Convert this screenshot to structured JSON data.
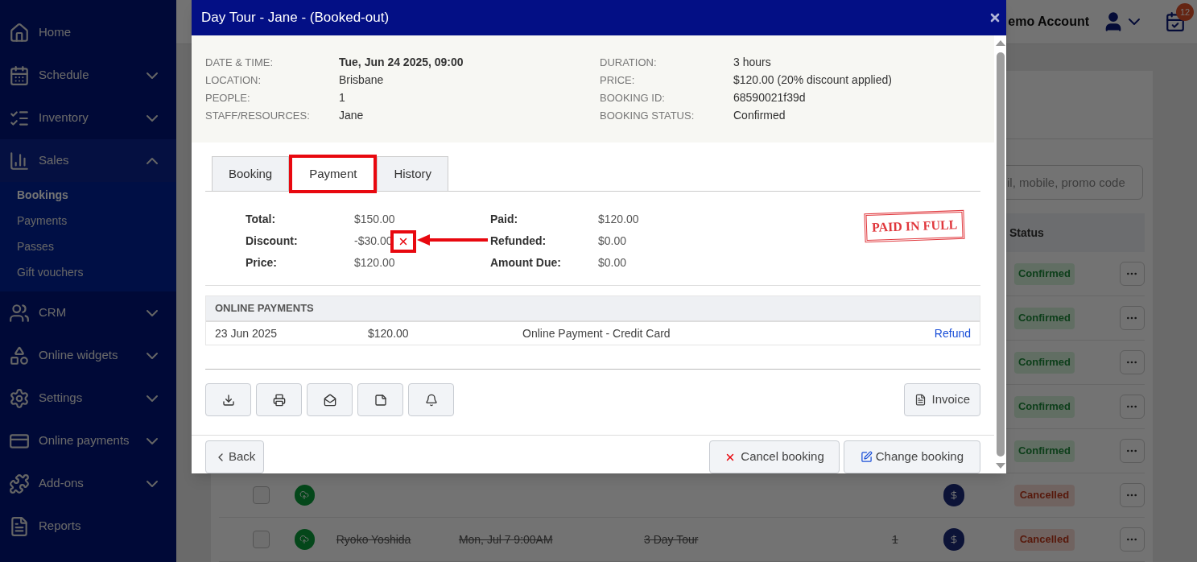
{
  "sidebar": {
    "items": [
      {
        "label": "Home",
        "expandable": false
      },
      {
        "label": "Schedule",
        "expandable": true,
        "expanded": false
      },
      {
        "label": "Inventory",
        "expandable": true,
        "expanded": false
      },
      {
        "label": "Sales",
        "expandable": true,
        "expanded": true,
        "children": [
          {
            "label": "Bookings",
            "selected": true
          },
          {
            "label": "Payments",
            "selected": false
          },
          {
            "label": "Passes",
            "selected": false
          },
          {
            "label": "Gift vouchers",
            "selected": false
          }
        ]
      },
      {
        "label": "CRM",
        "expandable": true,
        "expanded": false
      },
      {
        "label": "Online widgets",
        "expandable": true,
        "expanded": false
      },
      {
        "label": "Settings",
        "expandable": true,
        "expanded": false
      },
      {
        "label": "Online payments",
        "expandable": true,
        "expanded": false
      },
      {
        "label": "Add-ons",
        "expandable": true,
        "expanded": false
      },
      {
        "label": "Reports",
        "expandable": false
      }
    ]
  },
  "header": {
    "account": "emo Account",
    "notification_count": "12"
  },
  "bookings": {
    "search": {
      "placeholder": "il, mobile, promo code"
    },
    "columns": [
      "Status"
    ],
    "rows": [
      {
        "status": "Confirmed",
        "kind": "confirmed"
      },
      {
        "status": "Confirmed",
        "kind": "confirmed"
      },
      {
        "status": "Confirmed",
        "kind": "confirmed"
      },
      {
        "status": "Confirmed",
        "kind": "confirmed"
      },
      {
        "status": "Confirmed",
        "kind": "confirmed"
      },
      {
        "status": "Cancelled",
        "kind": "cancelled",
        "checked": false
      },
      {
        "name": "Ryoko Yoshida",
        "date": "Mon, Jul 7 9:00AM",
        "tour": "3 Day Tour",
        "quantity": "1",
        "status": "Cancelled",
        "kind": "cancelled",
        "checked": false
      }
    ]
  },
  "modal": {
    "title": "Day Tour - Jane - (Booked-out)",
    "details_left": [
      {
        "label": "DATE & TIME:",
        "value": "Tue, Jun 24 2025, 09:00",
        "bold": true
      },
      {
        "label": "LOCATION:",
        "value": "Brisbane",
        "bold": false
      },
      {
        "label": "PEOPLE:",
        "value": "1",
        "bold": false
      },
      {
        "label": "STAFF/RESOURCES:",
        "value": "Jane",
        "bold": false
      }
    ],
    "details_right": [
      {
        "label": "DURATION:",
        "value": "3 hours"
      },
      {
        "label": "PRICE:",
        "value": "$120.00 (20% discount applied)"
      },
      {
        "label": "BOOKING ID:",
        "value": "68590021f39d"
      },
      {
        "label": "BOOKING STATUS:",
        "value": "Confirmed"
      }
    ],
    "tabs": [
      {
        "label": "Booking",
        "selected": false,
        "highlighted": false
      },
      {
        "label": "Payment",
        "selected": true,
        "highlighted": true
      },
      {
        "label": "History",
        "selected": false,
        "highlighted": false
      }
    ],
    "summary_left": [
      {
        "label": "Total:",
        "value": "$150.00",
        "removable": false
      },
      {
        "label": "Discount:",
        "value": "-$30.00",
        "removable": true
      },
      {
        "label": "Price:",
        "value": "$120.00",
        "removable": false
      }
    ],
    "summary_right": [
      {
        "label": "Paid:",
        "value": "$120.00"
      },
      {
        "label": "Refunded:",
        "value": "$0.00"
      },
      {
        "label": "Amount Due:",
        "value": "$0.00"
      }
    ],
    "stamp": "PAID IN FULL",
    "online_payments": {
      "title": "ONLINE PAYMENTS",
      "rows": [
        {
          "date": "23 Jun 2025",
          "amount": "$120.00",
          "method": "Online Payment - Credit Card",
          "action": "Refund"
        }
      ]
    },
    "invoice_button": "Invoice",
    "back_button": "Back",
    "cancel_button": "Cancel booking",
    "change_button": "Change booking"
  }
}
